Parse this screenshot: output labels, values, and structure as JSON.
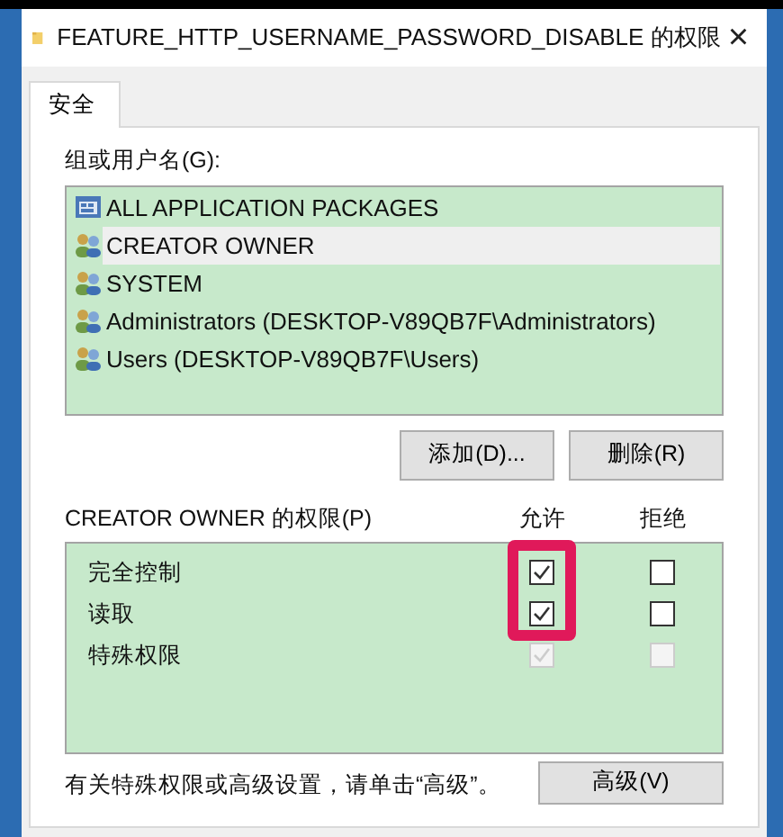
{
  "window": {
    "title": "FEATURE_HTTP_USERNAME_PASSWORD_DISABLE 的权限",
    "close": "×"
  },
  "tabs": [
    {
      "label": "安全",
      "selected": true
    }
  ],
  "groups": {
    "label": "组或用户名(G):",
    "items": [
      {
        "kind": "package",
        "name": "ALL APPLICATION PACKAGES",
        "selected": false
      },
      {
        "kind": "users",
        "name": "CREATOR OWNER",
        "selected": true
      },
      {
        "kind": "users",
        "name": "SYSTEM",
        "selected": false
      },
      {
        "kind": "users",
        "name": "Administrators (DESKTOP-V89QB7F\\Administrators)",
        "selected": false
      },
      {
        "kind": "users",
        "name": "Users (DESKTOP-V89QB7F\\Users)",
        "selected": false
      }
    ]
  },
  "group_buttons": [
    "添加(D)...",
    "删除(R)"
  ],
  "permissions": {
    "label": "CREATOR OWNER 的权限(P)",
    "allow_header": "允许",
    "deny_header": "拒绝",
    "allow_highlighted": true,
    "rows": [
      {
        "name": "完全控制",
        "allow": {
          "checked": true,
          "disabled": false
        },
        "deny": {
          "checked": false,
          "disabled": false
        }
      },
      {
        "name": "读取",
        "allow": {
          "checked": true,
          "disabled": false
        },
        "deny": {
          "checked": false,
          "disabled": false
        }
      },
      {
        "name": "特殊权限",
        "allow": {
          "checked": true,
          "disabled": true
        },
        "deny": {
          "checked": false,
          "disabled": true
        }
      }
    ]
  },
  "footer": {
    "text": "有关特殊权限或高级设置，请单击“高级”。",
    "button": "高级(V)"
  }
}
